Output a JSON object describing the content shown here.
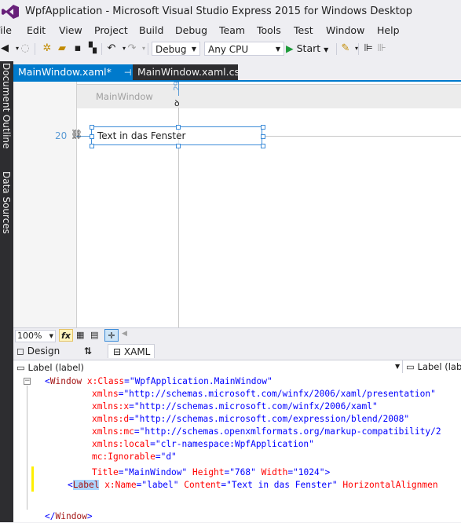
{
  "window": {
    "title": "WpfApplication - Microsoft Visual Studio Express 2015 for Windows Desktop"
  },
  "menu": [
    "File",
    "Edit",
    "View",
    "Project",
    "Build",
    "Debug",
    "Team",
    "Tools",
    "Test",
    "Window",
    "Help"
  ],
  "toolbar": {
    "config": "Debug",
    "platform": "Any CPU",
    "start_label": "Start"
  },
  "sidebar": {
    "document_outline": "Document Outline",
    "data_sources": "Data Sources"
  },
  "tabs": {
    "active": "MainWindow.xaml*",
    "inactive": "MainWindow.xaml.cs",
    "pin_glyph": "⊣",
    "close_glyph": "✕"
  },
  "designer": {
    "window_title": "MainWindow",
    "label_text": "Text in das Fenster",
    "margin_left": "20",
    "margin_top": "29"
  },
  "zoom": {
    "value": "100%"
  },
  "view_tabs": {
    "design": "Design",
    "swap": "⇅",
    "xaml": "XAML"
  },
  "breadcrumb": {
    "left": "Label (label)",
    "right": "Label (lab"
  },
  "code": {
    "l1_tag": "Window",
    "l1_attr": "x:Class",
    "l1_val": "\"WpfApplication.MainWindow\"",
    "l2_attr": "xmlns",
    "l2_val": "\"http://schemas.microsoft.com/winfx/2006/xaml/presentation\"",
    "l3_attr": "xmlns:x",
    "l3_val": "\"http://schemas.microsoft.com/winfx/2006/xaml\"",
    "l4_attr": "xmlns:d",
    "l4_val": "\"http://schemas.microsoft.com/expression/blend/2008\"",
    "l5_attr": "xmlns:mc",
    "l5_val": "\"http://schemas.openxmlformats.org/markup-compatibility/2",
    "l6_attr": "xmlns:local",
    "l6_val": "\"clr-namespace:WpfApplication\"",
    "l7_attr": "mc:Ignorable",
    "l7_val": "\"d\"",
    "l8_attr1": "Title",
    "l8_val1": "\"MainWindow\"",
    "l8_attr2": "Height",
    "l8_val2": "\"768\"",
    "l8_attr3": "Width",
    "l8_val3": "\"1024\"",
    "l9_tag": "Label",
    "l9_attr1": "x:Name",
    "l9_val1": "\"label\"",
    "l9_attr2": "Content",
    "l9_val2": "\"Text in das Fenster\"",
    "l9_attr3": "HorizontalAlignmen",
    "l11_tag": "Window"
  },
  "colors": {
    "accent": "#007acc",
    "vs_purple": "#68217a",
    "selection": "#add6ff"
  }
}
